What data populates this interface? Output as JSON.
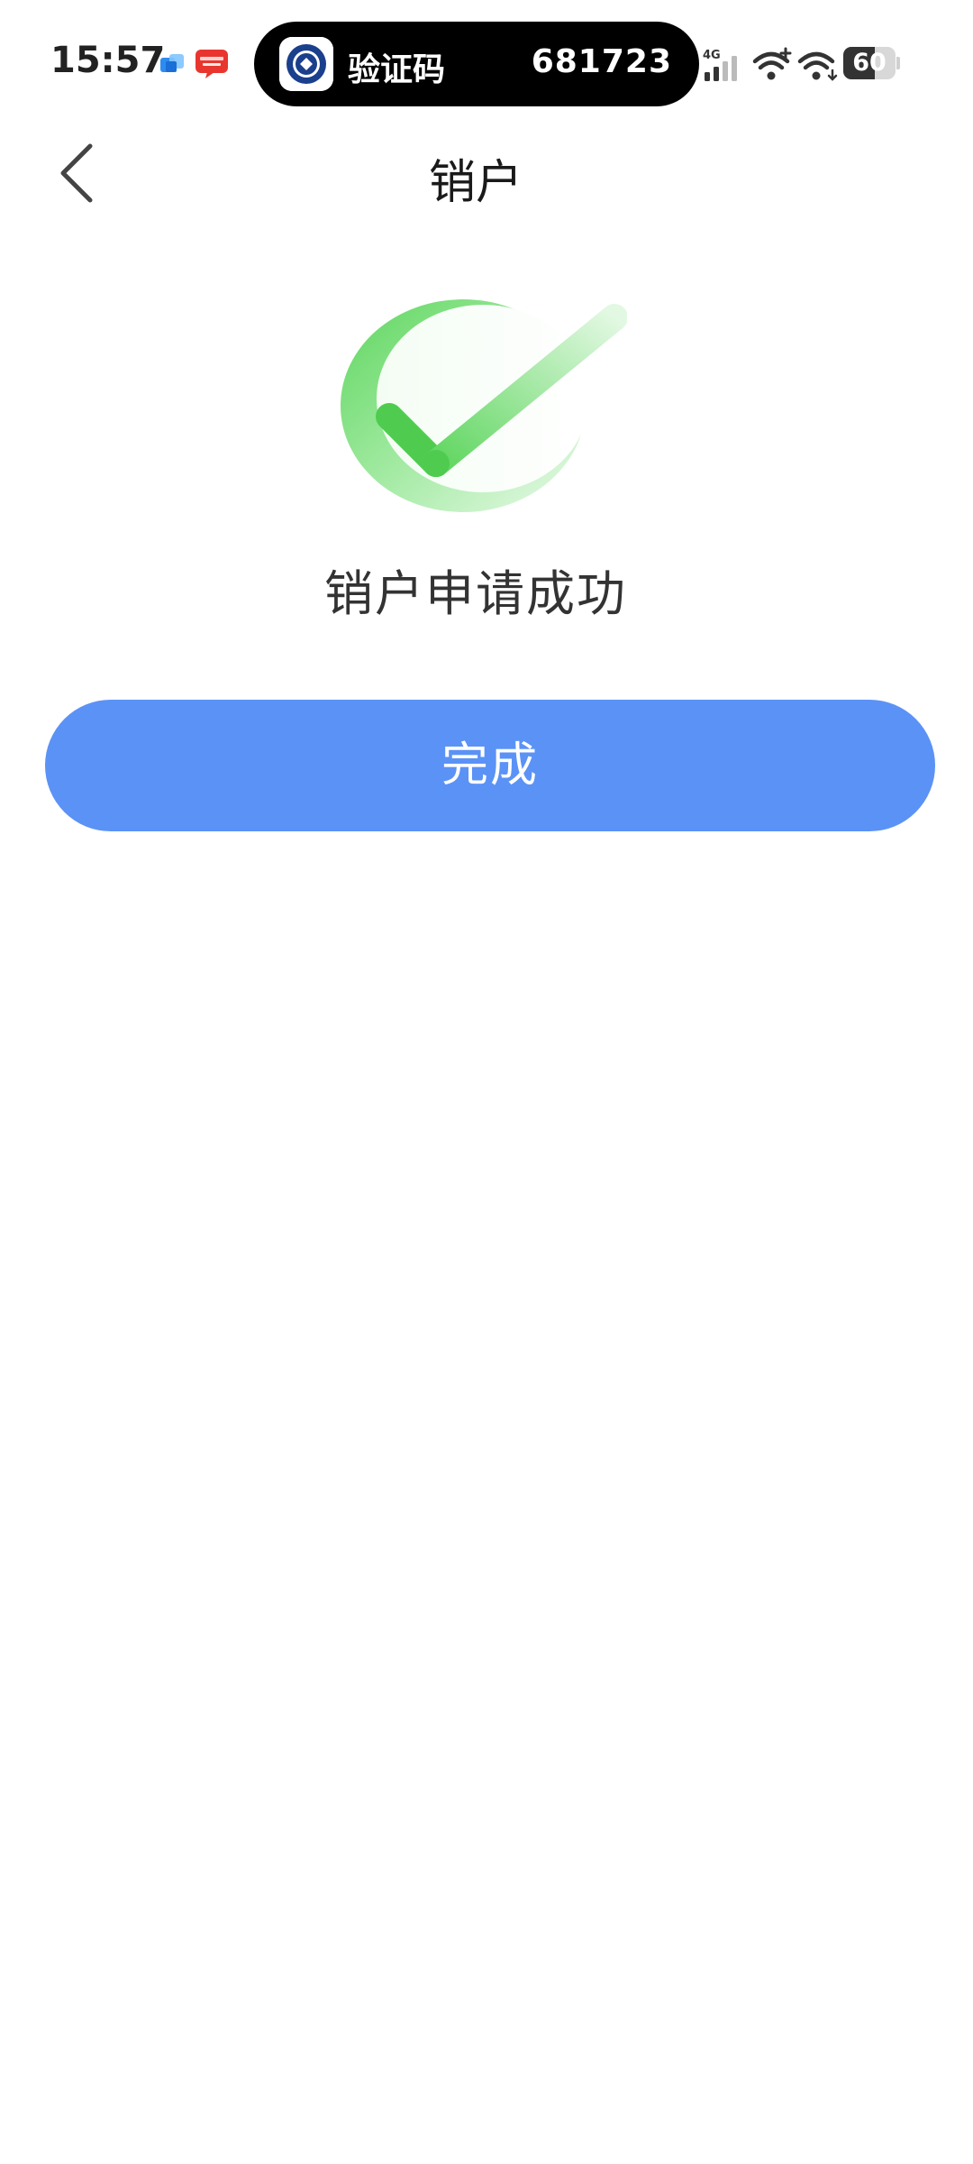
{
  "status_bar": {
    "time": "15:57",
    "island": {
      "label": "验证码",
      "code": "681723"
    },
    "network": "4G",
    "battery": {
      "level_percent": 60,
      "text": "60"
    }
  },
  "nav": {
    "title": "销户",
    "back_icon": "chevron-left-icon"
  },
  "result": {
    "icon": "success-check-icon",
    "message": "销户申请成功"
  },
  "actions": {
    "done_label": "完成"
  },
  "colors": {
    "primary_button": "#5b92f6",
    "success_green": "#52cc52",
    "title_text": "#1a1a1a",
    "body_text": "#333333"
  }
}
